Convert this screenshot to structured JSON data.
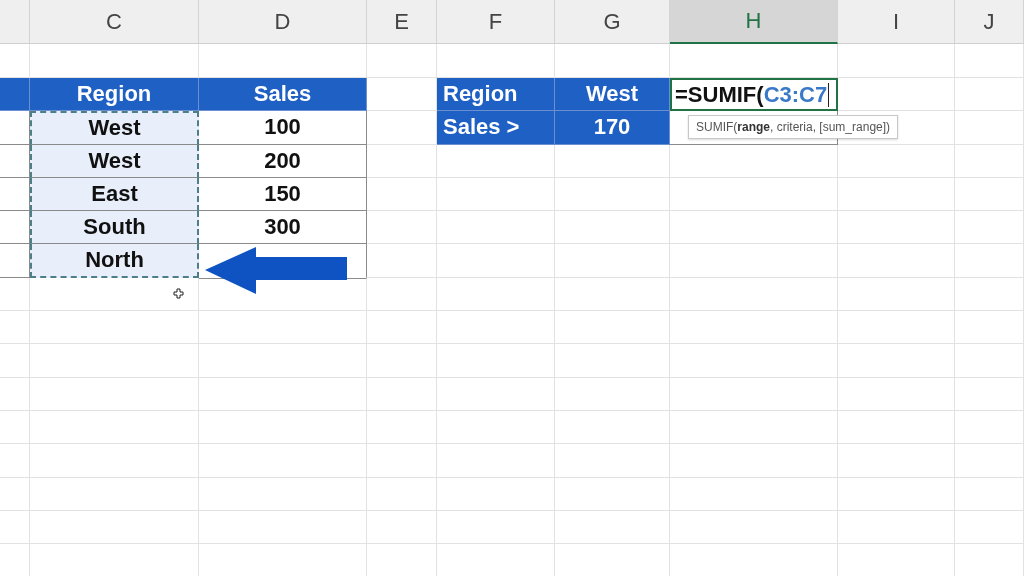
{
  "column_headers": [
    {
      "label": "C",
      "selected": false
    },
    {
      "label": "D",
      "selected": false
    },
    {
      "label": "E",
      "selected": false
    },
    {
      "label": "F",
      "selected": false
    },
    {
      "label": "G",
      "selected": false
    },
    {
      "label": "H",
      "selected": true
    },
    {
      "label": "I",
      "selected": false
    },
    {
      "label": "J",
      "selected": false
    }
  ],
  "left_table": {
    "columns": [
      "Region",
      "Sales"
    ],
    "rows": [
      {
        "region": "West",
        "sales": "100",
        "referenced": true
      },
      {
        "region": "West",
        "sales": "200",
        "referenced": true
      },
      {
        "region": "East",
        "sales": "150",
        "referenced": true
      },
      {
        "region": "South",
        "sales": "300",
        "referenced": true
      },
      {
        "region": "North",
        "sales": "",
        "referenced": true
      }
    ]
  },
  "criteria_table": [
    {
      "label": "Region",
      "value": "West"
    },
    {
      "label": "Sales >",
      "value": "170"
    }
  ],
  "active_cell": {
    "formula": "=SUMIF(",
    "reference": "C3:C7"
  },
  "tooltip": "SUMIF(**range**, criteria, [sum_range])"
}
